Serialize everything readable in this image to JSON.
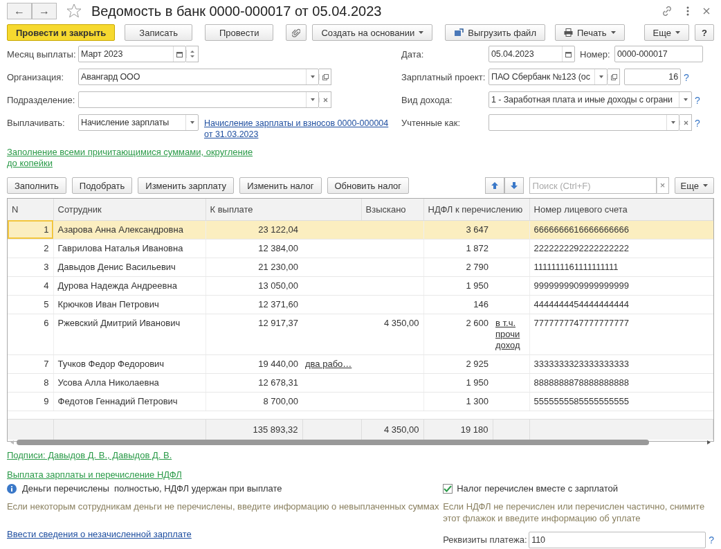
{
  "window": {
    "back": "←",
    "forward": "→",
    "title": "Ведомость в банк 0000-000017 от 05.04.2023",
    "favorite": false
  },
  "toolbar": [
    {
      "label": "Провести и закрыть",
      "kind": "primary"
    },
    {
      "label": "Записать",
      "kind": "plain"
    },
    {
      "label": "Провести",
      "kind": "plain"
    },
    {
      "kind": "clip"
    },
    {
      "label": "Создать на основании",
      "kind": "menu"
    },
    {
      "label": "Выгрузить файл",
      "kind": "export"
    },
    {
      "label": "Печать",
      "kind": "print"
    },
    {
      "label": "Еще",
      "kind": "more"
    },
    {
      "label": "?",
      "kind": "help"
    }
  ],
  "left_fields": [
    {
      "label": "Месяц выплаты:",
      "value": "Март 2023"
    },
    {
      "label": "Организация:",
      "value": "Авангард ООО"
    },
    {
      "label": "Подразделение:"
    },
    {
      "label": "Выплачивать:",
      "value": "Начисление зарплаты",
      "link": "Начисление зарплаты и взносов 0000-000004 от 31.03.2023"
    }
  ],
  "right_fields": [
    {
      "label": "Дата:",
      "value": "05.04.2023",
      "extra_label": "Номер:",
      "extra_value": "0000-000017"
    },
    {
      "label": "Зарплатный проект:",
      "value": "ПАО Сбербанк №123 (ос",
      "extra_value": "16",
      "help": "?"
    },
    {
      "label": "Вид дохода:",
      "value": "1 - Заработная плата и иные доходы с ограни",
      "help": "?"
    },
    {
      "label": "Учтенные как:",
      "help": "?"
    }
  ],
  "fill_link": "Заполнение всеми причитающимися суммами, округление до копейки",
  "table_toolbar": {
    "buttons": [
      "Заполнить",
      "Подобрать",
      "Изменить зарплату",
      "Изменить налог",
      "Обновить налог"
    ],
    "search": {
      "placeholder": "Поиск (Ctrl+F)",
      "clear": "×"
    },
    "more": "Еще"
  },
  "table": {
    "columns": [
      "N",
      "Сотрудник",
      "К выплате",
      "Взыскано",
      "НДФЛ к перечислению",
      "Номер лицевого счета"
    ],
    "rows": [
      {
        "n": "1",
        "employee": "Азарова Анна Александровна",
        "pay": "23 122,04",
        "ndfl": "3 647",
        "account": "6666666616666666666",
        "selected": true
      },
      {
        "n": "2",
        "employee": "Гаврилова Наталья Ивановна",
        "pay": "12 384,00",
        "ndfl": "1 872",
        "account": "2222222292222222222",
        "selected": false
      },
      {
        "n": "3",
        "employee": "Давыдов Денис Васильевич",
        "pay": "21 230,00",
        "ndfl": "2 790",
        "account": "1111111161111111111",
        "selected": false
      },
      {
        "n": "4",
        "employee": "Дурова Надежда Андреевна",
        "pay": "13 050,00",
        "ndfl": "1 950",
        "account": "9999999909999999999",
        "selected": false
      },
      {
        "n": "5",
        "employee": "Крючков Иван Петрович",
        "pay": "12 371,60",
        "ndfl": "146",
        "account": "4444444454444444444",
        "selected": false
      },
      {
        "n": "6",
        "employee": "Ржевский Дмитрий Иванович",
        "pay": "12 917,37",
        "recovered": "4 350,00",
        "ndfl": "2 600",
        "ndfl_note": "в т.ч. прочи доход",
        "account": "7777777747777777777",
        "selected": false
      },
      {
        "n": "7",
        "employee": "Тучков Федор Федорович",
        "pay": "19 440,00",
        "pay_note": "два рабо…",
        "ndfl": "2 925",
        "account": "3333333323333333333",
        "selected": false
      },
      {
        "n": "8",
        "employee": "Усова Алла Николаевна",
        "pay": "12 678,31",
        "ndfl": "1 950",
        "account": "8888888878888888888",
        "selected": false
      },
      {
        "n": "9",
        "employee": "Федотов Геннадий Петрович",
        "pay": "8 700,00",
        "ndfl": "1 300",
        "account": "5555555585555555555",
        "selected": false
      }
    ],
    "totals": {
      "pay": "135 893,32",
      "recovered": "4 350,00",
      "ndfl": "19 180"
    }
  },
  "signatures_link": "Подписи: Давыдов Д. В., Давыдов Д. В.",
  "payment_link": "Выплата зарплаты и перечисление НДФЛ",
  "info": "Деньги перечислены  полностью, НДФЛ удержан при выплате",
  "info_hint": "Если некоторым сотрудникам деньги не перечислены, введите информацию о невыплаченных суммах",
  "tax_checkbox": {
    "label": "Налог перечислен вместе с зарплатой",
    "checked": true
  },
  "tax_hint": "Если НДФЛ не перечислен или перечислен частично, снимите этот флажок и введите информацию об уплате",
  "unpaid_link": "Ввести сведения о незачисленной зарплате",
  "payment_details": {
    "label": "Реквизиты платежа:",
    "value": "110",
    "help": "?"
  }
}
